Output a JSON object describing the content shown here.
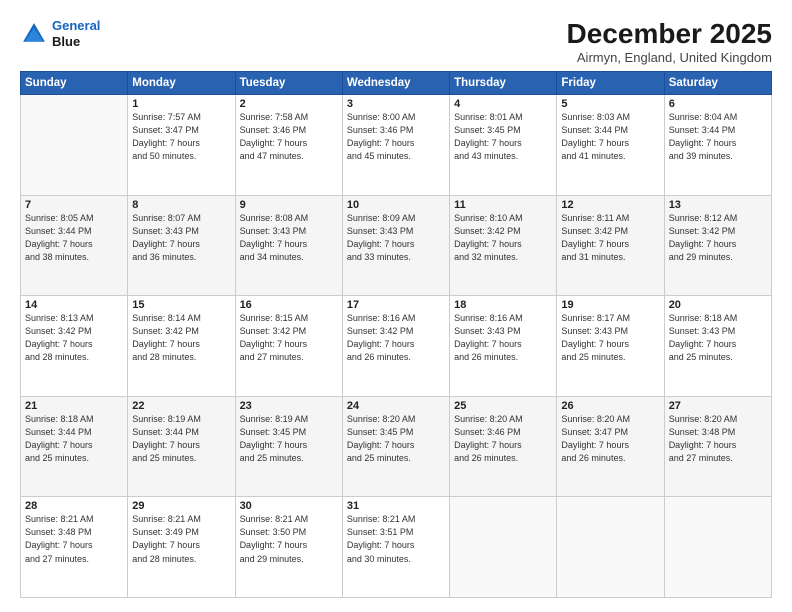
{
  "header": {
    "logo_line1": "General",
    "logo_line2": "Blue",
    "month": "December 2025",
    "location": "Airmyn, England, United Kingdom"
  },
  "days_of_week": [
    "Sunday",
    "Monday",
    "Tuesday",
    "Wednesday",
    "Thursday",
    "Friday",
    "Saturday"
  ],
  "weeks": [
    [
      {
        "day": "",
        "info": ""
      },
      {
        "day": "1",
        "info": "Sunrise: 7:57 AM\nSunset: 3:47 PM\nDaylight: 7 hours\nand 50 minutes."
      },
      {
        "day": "2",
        "info": "Sunrise: 7:58 AM\nSunset: 3:46 PM\nDaylight: 7 hours\nand 47 minutes."
      },
      {
        "day": "3",
        "info": "Sunrise: 8:00 AM\nSunset: 3:46 PM\nDaylight: 7 hours\nand 45 minutes."
      },
      {
        "day": "4",
        "info": "Sunrise: 8:01 AM\nSunset: 3:45 PM\nDaylight: 7 hours\nand 43 minutes."
      },
      {
        "day": "5",
        "info": "Sunrise: 8:03 AM\nSunset: 3:44 PM\nDaylight: 7 hours\nand 41 minutes."
      },
      {
        "day": "6",
        "info": "Sunrise: 8:04 AM\nSunset: 3:44 PM\nDaylight: 7 hours\nand 39 minutes."
      }
    ],
    [
      {
        "day": "7",
        "info": "Sunrise: 8:05 AM\nSunset: 3:44 PM\nDaylight: 7 hours\nand 38 minutes."
      },
      {
        "day": "8",
        "info": "Sunrise: 8:07 AM\nSunset: 3:43 PM\nDaylight: 7 hours\nand 36 minutes."
      },
      {
        "day": "9",
        "info": "Sunrise: 8:08 AM\nSunset: 3:43 PM\nDaylight: 7 hours\nand 34 minutes."
      },
      {
        "day": "10",
        "info": "Sunrise: 8:09 AM\nSunset: 3:43 PM\nDaylight: 7 hours\nand 33 minutes."
      },
      {
        "day": "11",
        "info": "Sunrise: 8:10 AM\nSunset: 3:42 PM\nDaylight: 7 hours\nand 32 minutes."
      },
      {
        "day": "12",
        "info": "Sunrise: 8:11 AM\nSunset: 3:42 PM\nDaylight: 7 hours\nand 31 minutes."
      },
      {
        "day": "13",
        "info": "Sunrise: 8:12 AM\nSunset: 3:42 PM\nDaylight: 7 hours\nand 29 minutes."
      }
    ],
    [
      {
        "day": "14",
        "info": "Sunrise: 8:13 AM\nSunset: 3:42 PM\nDaylight: 7 hours\nand 28 minutes."
      },
      {
        "day": "15",
        "info": "Sunrise: 8:14 AM\nSunset: 3:42 PM\nDaylight: 7 hours\nand 28 minutes."
      },
      {
        "day": "16",
        "info": "Sunrise: 8:15 AM\nSunset: 3:42 PM\nDaylight: 7 hours\nand 27 minutes."
      },
      {
        "day": "17",
        "info": "Sunrise: 8:16 AM\nSunset: 3:42 PM\nDaylight: 7 hours\nand 26 minutes."
      },
      {
        "day": "18",
        "info": "Sunrise: 8:16 AM\nSunset: 3:43 PM\nDaylight: 7 hours\nand 26 minutes."
      },
      {
        "day": "19",
        "info": "Sunrise: 8:17 AM\nSunset: 3:43 PM\nDaylight: 7 hours\nand 25 minutes."
      },
      {
        "day": "20",
        "info": "Sunrise: 8:18 AM\nSunset: 3:43 PM\nDaylight: 7 hours\nand 25 minutes."
      }
    ],
    [
      {
        "day": "21",
        "info": "Sunrise: 8:18 AM\nSunset: 3:44 PM\nDaylight: 7 hours\nand 25 minutes."
      },
      {
        "day": "22",
        "info": "Sunrise: 8:19 AM\nSunset: 3:44 PM\nDaylight: 7 hours\nand 25 minutes."
      },
      {
        "day": "23",
        "info": "Sunrise: 8:19 AM\nSunset: 3:45 PM\nDaylight: 7 hours\nand 25 minutes."
      },
      {
        "day": "24",
        "info": "Sunrise: 8:20 AM\nSunset: 3:45 PM\nDaylight: 7 hours\nand 25 minutes."
      },
      {
        "day": "25",
        "info": "Sunrise: 8:20 AM\nSunset: 3:46 PM\nDaylight: 7 hours\nand 26 minutes."
      },
      {
        "day": "26",
        "info": "Sunrise: 8:20 AM\nSunset: 3:47 PM\nDaylight: 7 hours\nand 26 minutes."
      },
      {
        "day": "27",
        "info": "Sunrise: 8:20 AM\nSunset: 3:48 PM\nDaylight: 7 hours\nand 27 minutes."
      }
    ],
    [
      {
        "day": "28",
        "info": "Sunrise: 8:21 AM\nSunset: 3:48 PM\nDaylight: 7 hours\nand 27 minutes."
      },
      {
        "day": "29",
        "info": "Sunrise: 8:21 AM\nSunset: 3:49 PM\nDaylight: 7 hours\nand 28 minutes."
      },
      {
        "day": "30",
        "info": "Sunrise: 8:21 AM\nSunset: 3:50 PM\nDaylight: 7 hours\nand 29 minutes."
      },
      {
        "day": "31",
        "info": "Sunrise: 8:21 AM\nSunset: 3:51 PM\nDaylight: 7 hours\nand 30 minutes."
      },
      {
        "day": "",
        "info": ""
      },
      {
        "day": "",
        "info": ""
      },
      {
        "day": "",
        "info": ""
      }
    ]
  ]
}
